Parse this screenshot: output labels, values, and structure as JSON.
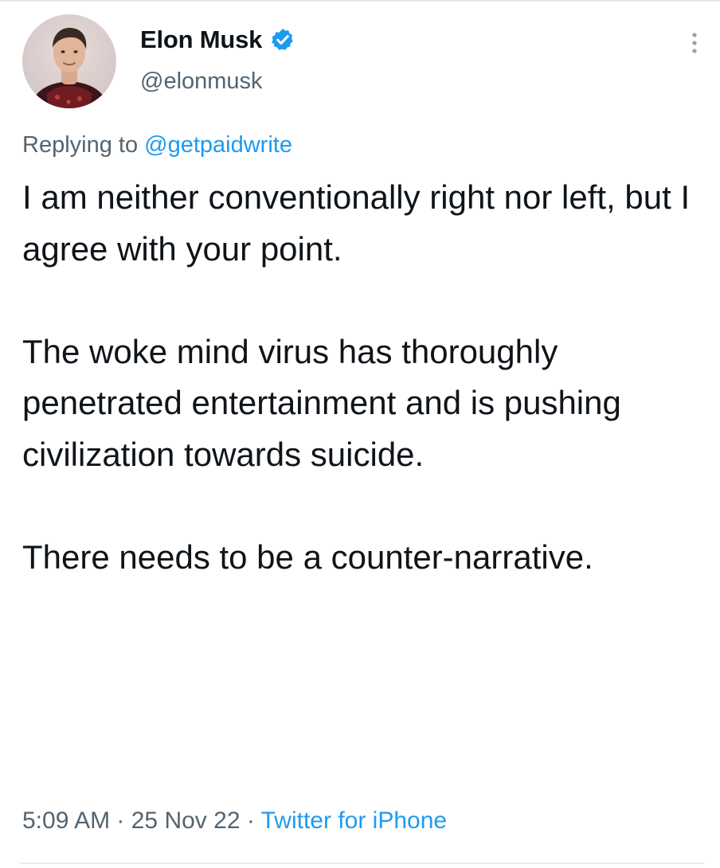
{
  "author": {
    "display_name": "Elon Musk",
    "handle": "@elonmusk",
    "verified": true,
    "avatar_icon": "profile-photo"
  },
  "reply": {
    "prefix": "Replying to ",
    "mention": "@getpaidwrite"
  },
  "tweet": {
    "paragraphs": [
      "I am neither conventionally right nor left, but I agree with your point.",
      "The woke mind virus has thoroughly penetrated entertainment and is pushing civilization towards suicide.",
      "There needs to be a counter-narrative."
    ]
  },
  "meta": {
    "time": "5:09 AM",
    "sep1": " · ",
    "date": "25 Nov 22",
    "sep2": " · ",
    "source": "Twitter for iPhone"
  },
  "icons": {
    "verified": "verified-badge-icon",
    "more": "more-options-icon"
  },
  "colors": {
    "accent": "#1d9bf0",
    "secondary_text": "#536471",
    "primary_text": "#0f1419"
  }
}
